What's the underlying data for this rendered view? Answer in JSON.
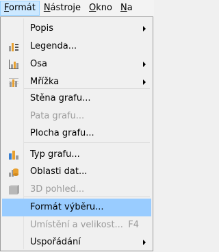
{
  "menubar": {
    "items": [
      "Formát",
      "Nástroje",
      "Okno",
      "Na"
    ]
  },
  "menu": {
    "items": [
      {
        "label": "Popis",
        "submenu": true
      },
      {
        "label": "Legenda...",
        "icon": "legend-icon"
      },
      {
        "label": "Osa",
        "icon": "axis-icon",
        "submenu": true
      },
      {
        "label": "Mřížka",
        "icon": "grid-icon",
        "submenu": true
      },
      {
        "label": "Stěna grafu..."
      },
      {
        "label": "Pata grafu...",
        "disabled": true
      },
      {
        "label": "Plocha grafu..."
      },
      {
        "label": "Typ grafu...",
        "icon": "chart-type-icon"
      },
      {
        "label": "Oblasti dat...",
        "icon": "data-ranges-icon"
      },
      {
        "label": "3D pohled...",
        "icon": "3d-view-icon",
        "disabled": true
      },
      {
        "label": "Formát výběru...",
        "highlighted": true
      },
      {
        "label": "Umístění a velikost...",
        "shortcut": "F4",
        "disabled": true
      },
      {
        "label": "Uspořádání",
        "submenu": true
      }
    ]
  },
  "colors": {
    "highlight": "#99ccff",
    "menubar_active": "#cce8ff",
    "disabled_text": "#9a9a9a"
  }
}
